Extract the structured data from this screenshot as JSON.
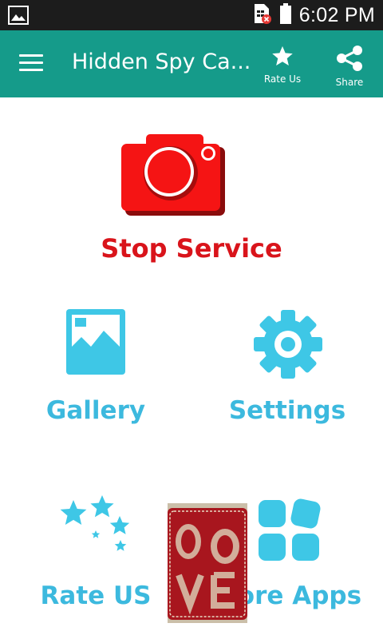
{
  "status_bar": {
    "time": "6:02 PM",
    "icons": [
      "image-notification-icon",
      "sim-error-icon",
      "battery-icon"
    ]
  },
  "app_bar": {
    "title": "Hidden Spy Ca...",
    "menu_icon": "hamburger-menu-icon",
    "actions": [
      {
        "icon": "star-icon",
        "label": "Rate Us"
      },
      {
        "icon": "share-icon",
        "label": "Share"
      }
    ],
    "color": "#159b8a"
  },
  "main": {
    "service_button": {
      "icon": "camera-icon",
      "label": "Stop Service",
      "color": "#d9141b"
    },
    "tiles": [
      {
        "icon": "gallery-icon",
        "label": "Gallery"
      },
      {
        "icon": "settings-gear-icon",
        "label": "Settings"
      },
      {
        "icon": "stars-icon",
        "label": "Rate US"
      },
      {
        "icon": "apps-grid-icon",
        "label": "More Apps"
      }
    ],
    "accent_color": "#3cb9de"
  },
  "ad": {
    "icon": "advertisement-image"
  }
}
